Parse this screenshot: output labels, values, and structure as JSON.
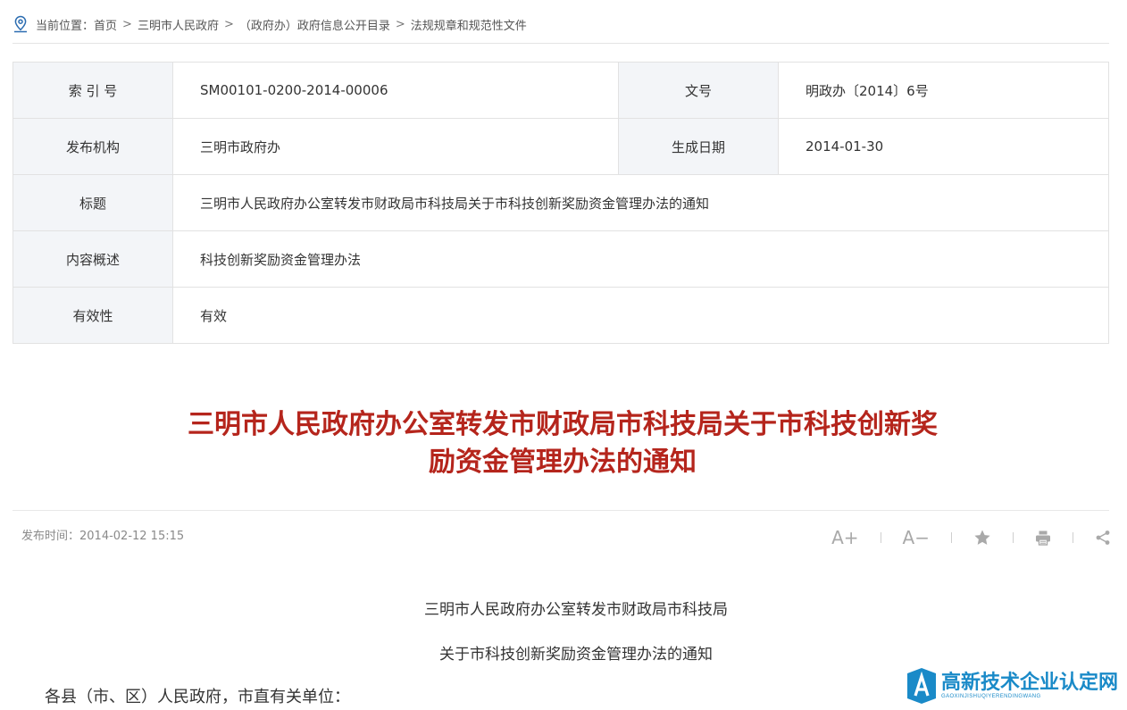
{
  "breadcrumb": {
    "label": "当前位置：",
    "items": [
      "首页",
      "三明市人民政府",
      "（政府办）政府信息公开目录",
      "法规规章和规范性文件"
    ],
    "separator": ">"
  },
  "meta": {
    "index_label": "索 引 号",
    "index_value": "SM00101-0200-2014-00006",
    "docno_label": "文号",
    "docno_value": "明政办〔2014〕6号",
    "issuer_label": "发布机构",
    "issuer_value": "三明市政府办",
    "date_label": "生成日期",
    "date_value": "2014-01-30",
    "title_label": "标题",
    "title_value": "三明市人民政府办公室转发市财政局市科技局关于市科技创新奖励资金管理办法的通知",
    "summary_label": "内容概述",
    "summary_value": "科技创新奖励资金管理办法",
    "validity_label": "有效性",
    "validity_value": "有效"
  },
  "article": {
    "title_line1": "三明市人民政府办公室转发市财政局市科技局关于市科技创新奖",
    "title_line2": "励资金管理办法的通知",
    "publish_time": "发布时间：2014-02-12 15:15",
    "body_line1": "三明市人民政府办公室转发市财政局市科技局",
    "body_line2": "关于市科技创新奖励资金管理办法的通知",
    "salutation": "各县（市、区）人民政府，市直有关单位："
  },
  "tools": {
    "font_increase": "A+",
    "font_decrease": "A−"
  },
  "watermark": {
    "main": "高新技术企业认定网",
    "sub": "GAOXINJISHUQIYERENDINGWANG"
  },
  "colors": {
    "title_red": "#b5251c",
    "label_bg": "#f3f5f8",
    "watermark_blue": "#1a8ac8"
  }
}
